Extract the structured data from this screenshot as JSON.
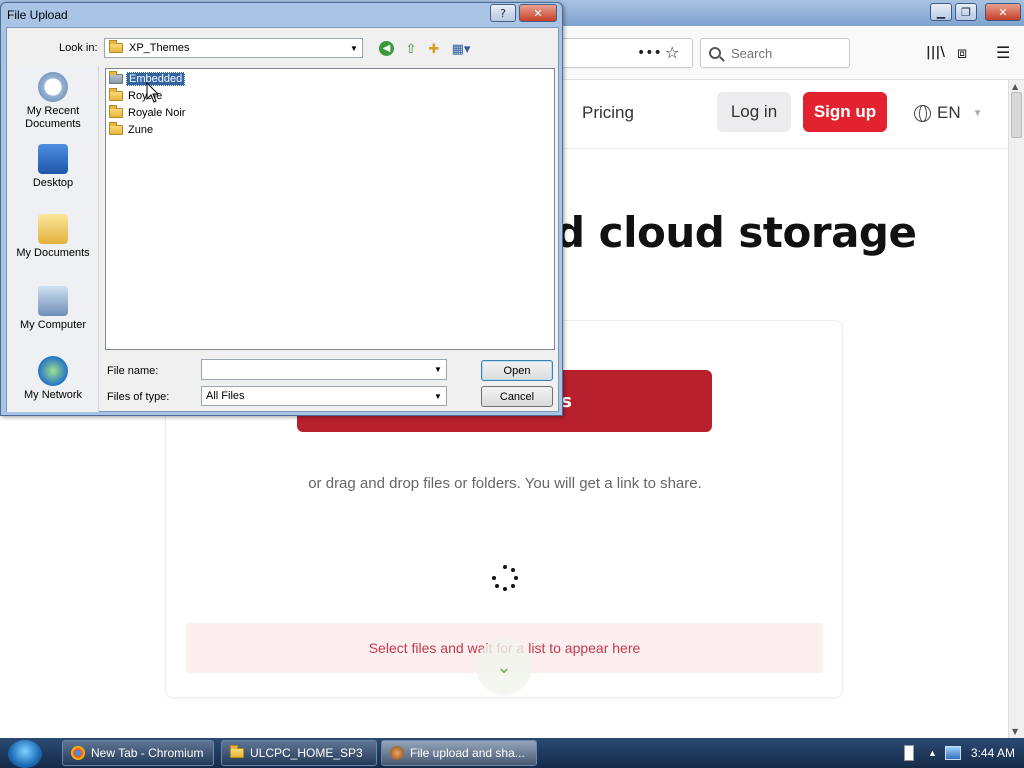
{
  "browser": {
    "search_placeholder": "Search",
    "menu_dots": "•••",
    "star": "☆",
    "library": "|||\\",
    "sidebar": "⧈",
    "hamburger": "☰"
  },
  "page": {
    "nav": {
      "pricing": "Pricing",
      "login": "Log in",
      "signup": "Sign up",
      "language": "EN"
    },
    "hero_fragment": "d cloud storage",
    "upload_button_fragment": "s",
    "drag_text": "or drag and drop files or folders. You will get a link to share.",
    "list_placeholder": "Select files and wait for a list to appear here"
  },
  "dialog": {
    "title": "File Upload",
    "help": "?",
    "close": "✕",
    "look_in_label": "Look in:",
    "look_in_value": "XP_Themes",
    "places": [
      "My Recent Documents",
      "Desktop",
      "My Documents",
      "My Computer",
      "My Network"
    ],
    "files": [
      "Embedded",
      "Royale",
      "Royale Noir",
      "Zune"
    ],
    "file_name_label": "File name:",
    "file_name_value": "",
    "files_of_type_label": "Files of type:",
    "files_of_type_value": "All Files",
    "open_label": "Open",
    "cancel_label": "Cancel"
  },
  "taskbar": {
    "tasks": [
      "New Tab - Chromium",
      "ULCPC_HOME_SP3",
      "File upload and sha..."
    ],
    "clock": "3:44 AM"
  },
  "colors": {
    "brand_red": "#e2222f",
    "upload_red": "#b8202e",
    "selection_blue": "#3163a5"
  }
}
